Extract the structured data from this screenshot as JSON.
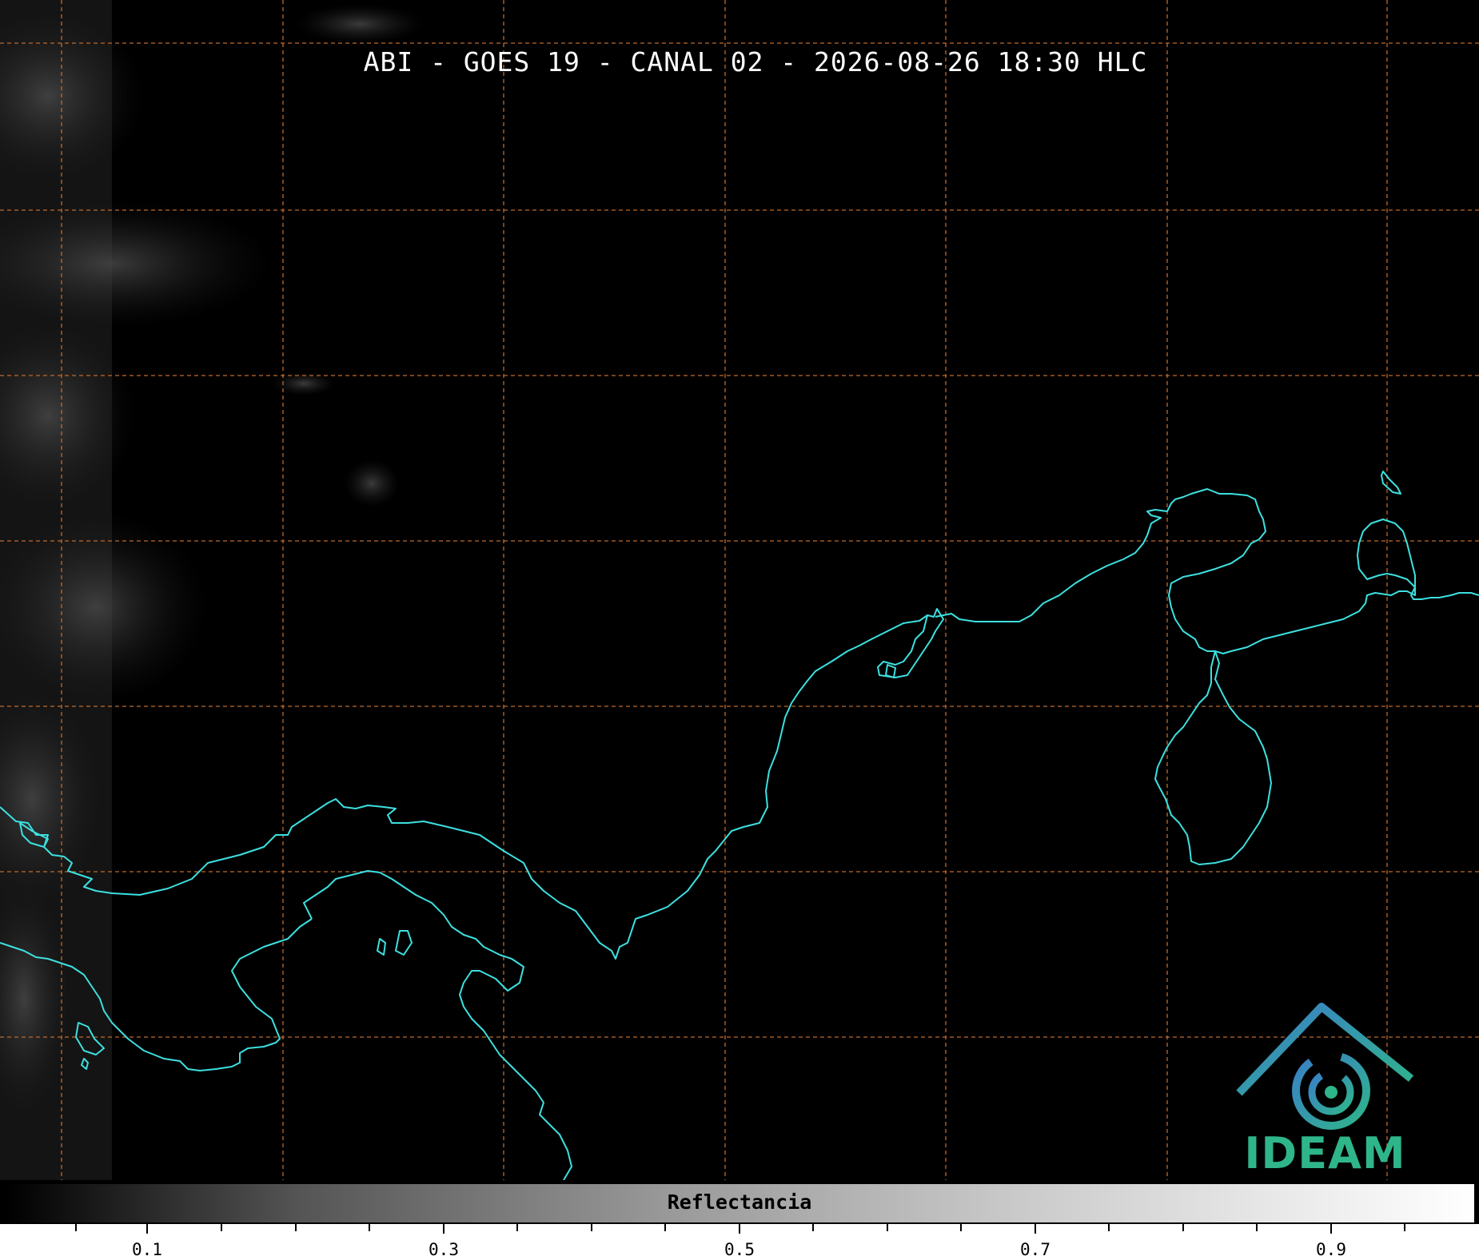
{
  "title": "ABI - GOES 19 - CANAL 02 - 2026-08-26 18:30 HLC",
  "colorbar": {
    "label": "Reflectancia",
    "tick_labels": [
      "0.1",
      "0.3",
      "0.5",
      "0.7",
      "0.9"
    ]
  },
  "logo": {
    "text": "IDEAM"
  },
  "colors": {
    "coastline": "#3de0e0",
    "gridlines": "#c06a2a",
    "logo_green": "#2fb58a",
    "logo_blue": "#3a7ec8"
  }
}
